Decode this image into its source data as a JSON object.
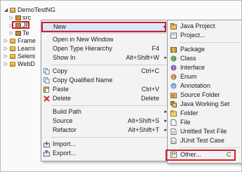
{
  "tree": {
    "project": "DemoTestNG",
    "src": "src",
    "jre": "JR",
    "testng": "Te",
    "items": [
      "Frame",
      "Learni",
      "Seleni",
      "WebD"
    ]
  },
  "menu": [
    {
      "label": "New",
      "key": "",
      "arrow": "▸",
      "icon": "blank"
    },
    {
      "label": "Open in New Window",
      "key": "",
      "icon": "blank"
    },
    {
      "label": "Open Type Hierarchy",
      "key": "F4",
      "icon": "blank"
    },
    {
      "label": "Show In",
      "key": "Alt+Shift+W",
      "arrow": "▸",
      "icon": "blank"
    },
    {
      "label": "Copy",
      "key": "Ctrl+C",
      "icon": "copy-icon"
    },
    {
      "label": "Copy Qualified Name",
      "key": "",
      "icon": "copy-icon"
    },
    {
      "label": "Paste",
      "key": "Ctrl+V",
      "icon": "paste-icon"
    },
    {
      "label": "Delete",
      "key": "Delete",
      "icon": "delete-icon"
    },
    {
      "label": "Build Path",
      "key": "",
      "arrow": "▸",
      "icon": "blank"
    },
    {
      "label": "Source",
      "key": "Alt+Shift+S",
      "arrow": "▸",
      "icon": "blank"
    },
    {
      "label": "Refactor",
      "key": "Alt+Shift+T",
      "arrow": "▸",
      "icon": "blank"
    },
    {
      "label": "Import...",
      "key": "",
      "icon": "import-icon"
    },
    {
      "label": "Export...",
      "key": "",
      "icon": "export-icon"
    }
  ],
  "submenu": [
    {
      "label": "Java Project",
      "icon": "java-project-icon"
    },
    {
      "label": "Project...",
      "icon": "project-icon"
    },
    {
      "label": "Package",
      "icon": "package-icon"
    },
    {
      "label": "Class",
      "icon": "class-icon"
    },
    {
      "label": "Interface",
      "icon": "interface-icon"
    },
    {
      "label": "Enum",
      "icon": "enum-icon"
    },
    {
      "label": "Annotation",
      "icon": "annotation-icon"
    },
    {
      "label": "Source Folder",
      "icon": "source-folder-icon"
    },
    {
      "label": "Java Working Set",
      "icon": "working-set-icon"
    },
    {
      "label": "Folder",
      "icon": "folder-icon"
    },
    {
      "label": "File",
      "icon": "file-icon"
    },
    {
      "label": "Untitled Text File",
      "icon": "text-file-icon"
    },
    {
      "label": "JUnit Test Case",
      "icon": "junit-icon"
    },
    {
      "label": "Other...",
      "icon": "other-icon",
      "peek": "C"
    }
  ],
  "colors": {
    "highlight": "#d3202a",
    "menu_bg": "#f3f3f3",
    "selection": "#dbe7f6"
  }
}
